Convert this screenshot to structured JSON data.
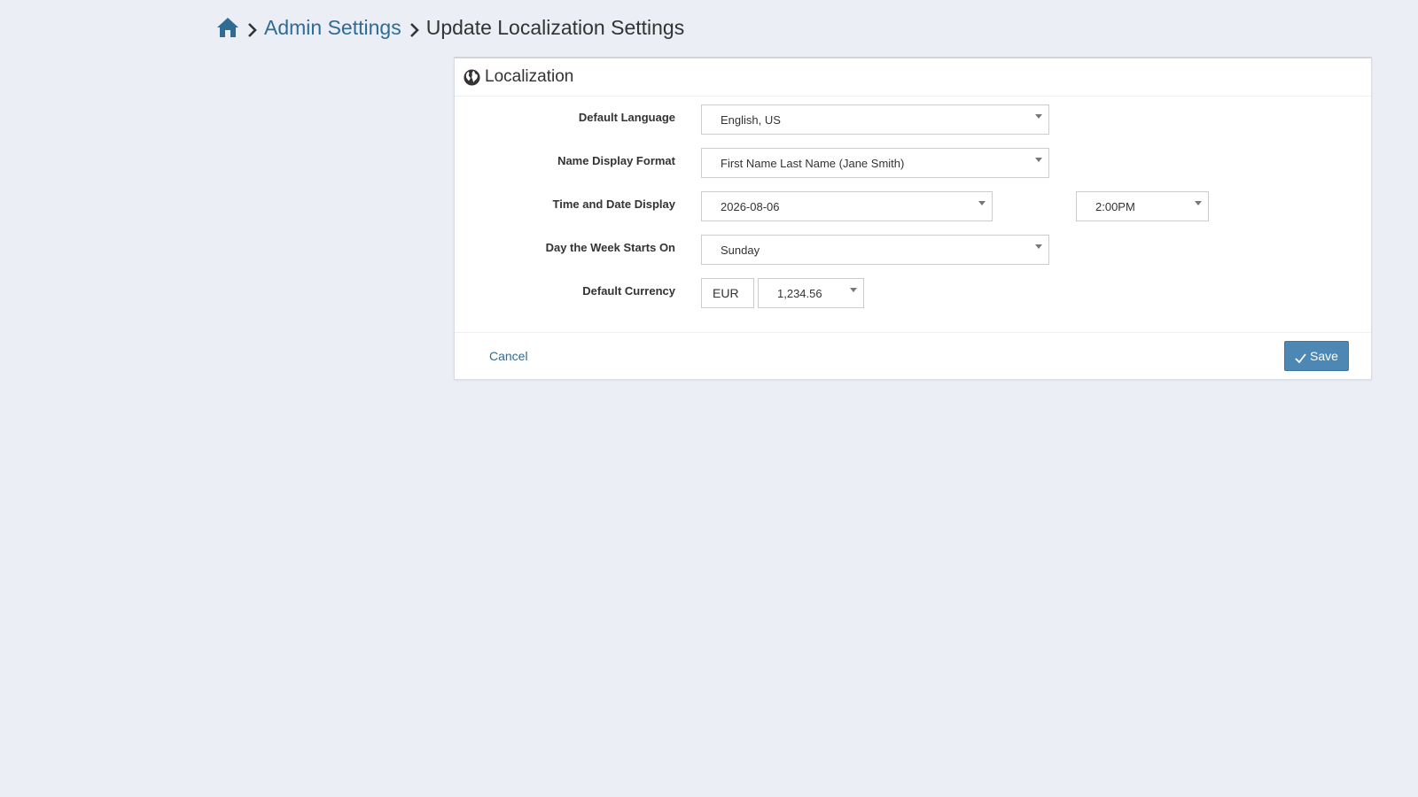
{
  "breadcrumb": {
    "home_icon": "home-icon",
    "admin_settings": "Admin Settings",
    "current": "Update Localization Settings"
  },
  "panel": {
    "title": "Localization",
    "title_icon": "globe-icon",
    "fields": {
      "default_language": {
        "label": "Default Language",
        "value": "English, US"
      },
      "name_display_format": {
        "label": "Name Display Format",
        "value": "First Name Last Name (Jane Smith)"
      },
      "time_date_display": {
        "label": "Time and Date Display",
        "date_value": "2026-08-06",
        "time_value": "2:00PM"
      },
      "week_start": {
        "label": "Day the Week Starts On",
        "value": "Sunday"
      },
      "default_currency": {
        "label": "Default Currency",
        "code": "EUR",
        "format": "1,234.56"
      }
    },
    "footer": {
      "cancel_label": "Cancel",
      "save_label": "Save"
    }
  },
  "colors": {
    "accent": "#4d88b5",
    "link": "#2f6b93",
    "background": "#ebeef5"
  }
}
